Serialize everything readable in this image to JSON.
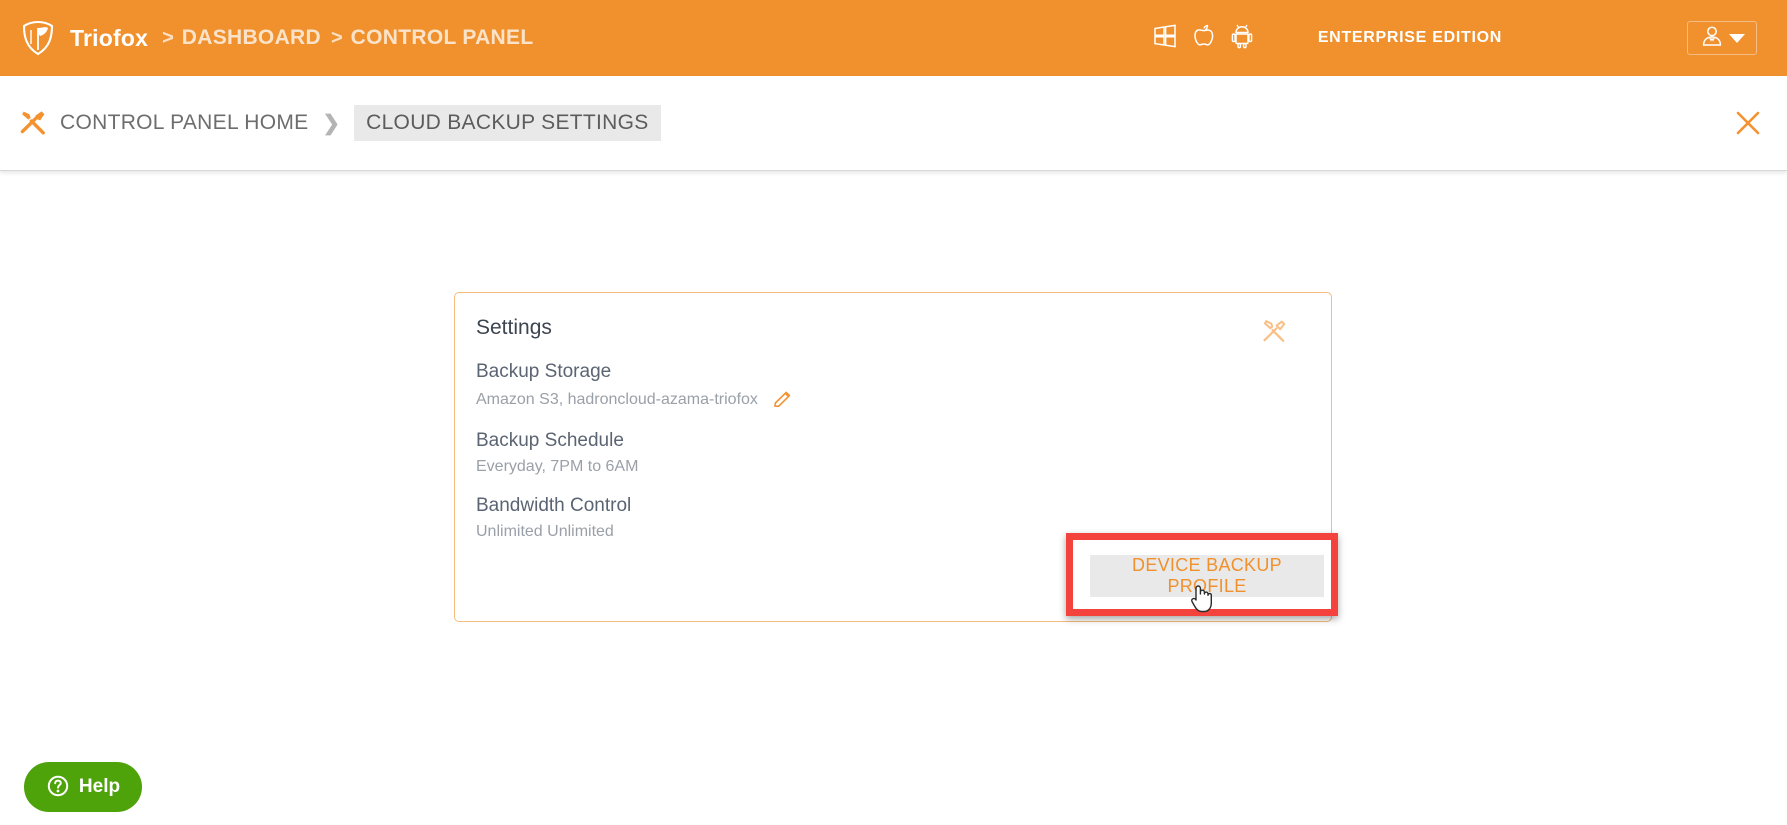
{
  "header": {
    "brand": "Triofox",
    "separator": ">",
    "crumbs": [
      "DASHBOARD",
      "CONTROL PANEL"
    ],
    "platform_icons": [
      "windows-icon",
      "apple-icon",
      "android-icon"
    ],
    "edition": "ENTERPRISE EDITION",
    "user_icon": "user-avatar-icon",
    "dropdown_icon": "chevron-down-icon",
    "background_color": "#f0912e"
  },
  "breadcrumb": {
    "tools_icon": "tools-icon",
    "home": "CONTROL PANEL HOME",
    "arrow": "❯",
    "current": "CLOUD BACKUP SETTINGS",
    "close_icon": "close-icon"
  },
  "card": {
    "title": "Settings",
    "tools_icon": "tools-icon",
    "border_color": "#f5bc7d",
    "settings": [
      {
        "label": "Backup Storage",
        "value": "Amazon S3, hadroncloud-azama-triofox",
        "edit_icon": "pencil-icon"
      },
      {
        "label": "Backup Schedule",
        "value": "Everyday, 7PM to 6AM"
      },
      {
        "label": "Bandwidth Control",
        "value": "Unlimited Unlimited"
      }
    ],
    "action_button": {
      "label": "DEVICE BACKUP PROFILE",
      "text_color": "#f0912e",
      "background_color": "#e9e9e9"
    }
  },
  "annotation": {
    "highlight_color": "#f4433c",
    "target": "DEVICE BACKUP PROFILE"
  },
  "help": {
    "label": "Help",
    "icon": "question-circle-icon",
    "background_color": "#4ea20a"
  }
}
